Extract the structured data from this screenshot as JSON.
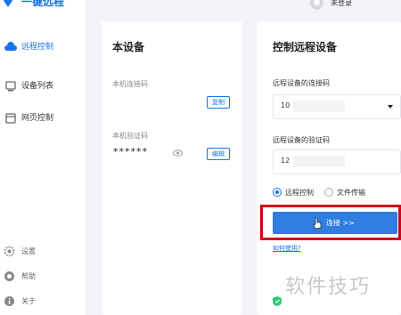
{
  "app": {
    "title": "一键远程"
  },
  "sidebar": {
    "items": [
      {
        "label": "远程控制",
        "icon": "cloud-remote-icon",
        "active": true
      },
      {
        "label": "设备列表",
        "icon": "device-list-icon",
        "active": false
      },
      {
        "label": "网页控制",
        "icon": "web-page-icon",
        "active": false
      }
    ],
    "bottom": [
      {
        "label": "设置",
        "icon": "gear-icon"
      },
      {
        "label": "帮助",
        "icon": "help-icon"
      },
      {
        "label": "关于",
        "icon": "info-icon"
      }
    ]
  },
  "topbar": {
    "user_label": "未登录"
  },
  "this_device": {
    "title": "本设备",
    "code_label": "本机连接码",
    "copy_button": "复制",
    "verify_label": "本机验证码",
    "verify_value": "******",
    "edit_button": "编辑"
  },
  "remote": {
    "title": "控制远程设备",
    "code_label": "远程设备的连接码",
    "code_value": "10",
    "verify_label": "远程设备的验证码",
    "verify_value": "12",
    "mode_options": [
      "远程控制",
      "文件传输"
    ],
    "selected_mode": "远程控制",
    "connect_button": "连接 >>",
    "help_link": "如何使用?"
  },
  "watermark": "软件技巧",
  "colors": {
    "accent": "#1a73e8",
    "button": "#2f7de1",
    "highlight": "#d0021b"
  }
}
